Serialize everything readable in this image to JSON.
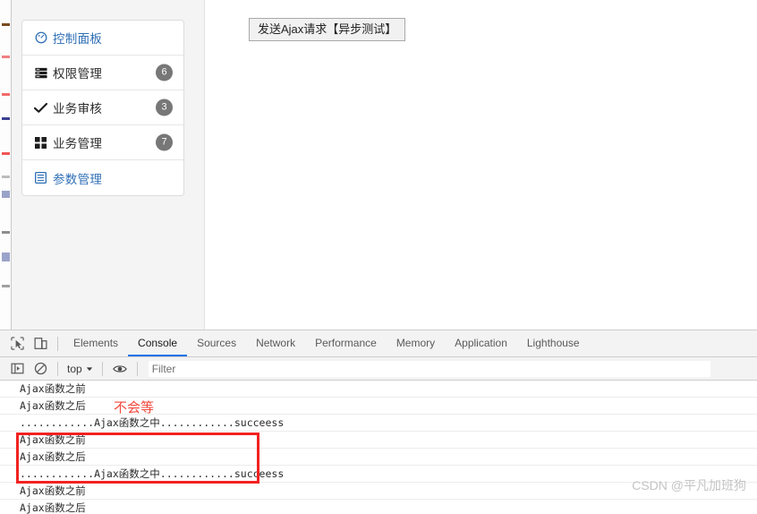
{
  "page": {
    "ajax_button_label": "发送Ajax请求【异步测试】",
    "sidebar": {
      "items": [
        {
          "icon": "dashboard-icon",
          "label": "控制面板",
          "badge": "",
          "style": "link"
        },
        {
          "icon": "server-icon",
          "label": "权限管理",
          "badge": "6",
          "style": "plain"
        },
        {
          "icon": "check-icon",
          "label": "业务审核",
          "badge": "3",
          "style": "plain"
        },
        {
          "icon": "grid-icon",
          "label": "业务管理",
          "badge": "7",
          "style": "plain"
        },
        {
          "icon": "list-alt-icon",
          "label": "参数管理",
          "badge": "",
          "style": "link"
        }
      ]
    }
  },
  "devtools": {
    "tabs": [
      {
        "label": "Elements",
        "active": false
      },
      {
        "label": "Console",
        "active": true
      },
      {
        "label": "Sources",
        "active": false
      },
      {
        "label": "Network",
        "active": false
      },
      {
        "label": "Performance",
        "active": false
      },
      {
        "label": "Memory",
        "active": false
      },
      {
        "label": "Application",
        "active": false
      },
      {
        "label": "Lighthouse",
        "active": false
      }
    ],
    "toolbar": {
      "context_label": "top",
      "filter_placeholder": "Filter"
    },
    "console_messages": [
      "Ajax函数之前",
      "Ajax函数之后",
      "............Ajax函数之中............succeess",
      "Ajax函数之前",
      "Ajax函数之后",
      "............Ajax函数之中............succeess",
      "Ajax函数之前",
      "Ajax函数之后"
    ]
  },
  "annotation": {
    "note_text": "不会等",
    "box_color": "#f22222",
    "note_color": "#f1483c"
  },
  "watermark": {
    "text": "CSDN @平凡加班狗"
  }
}
